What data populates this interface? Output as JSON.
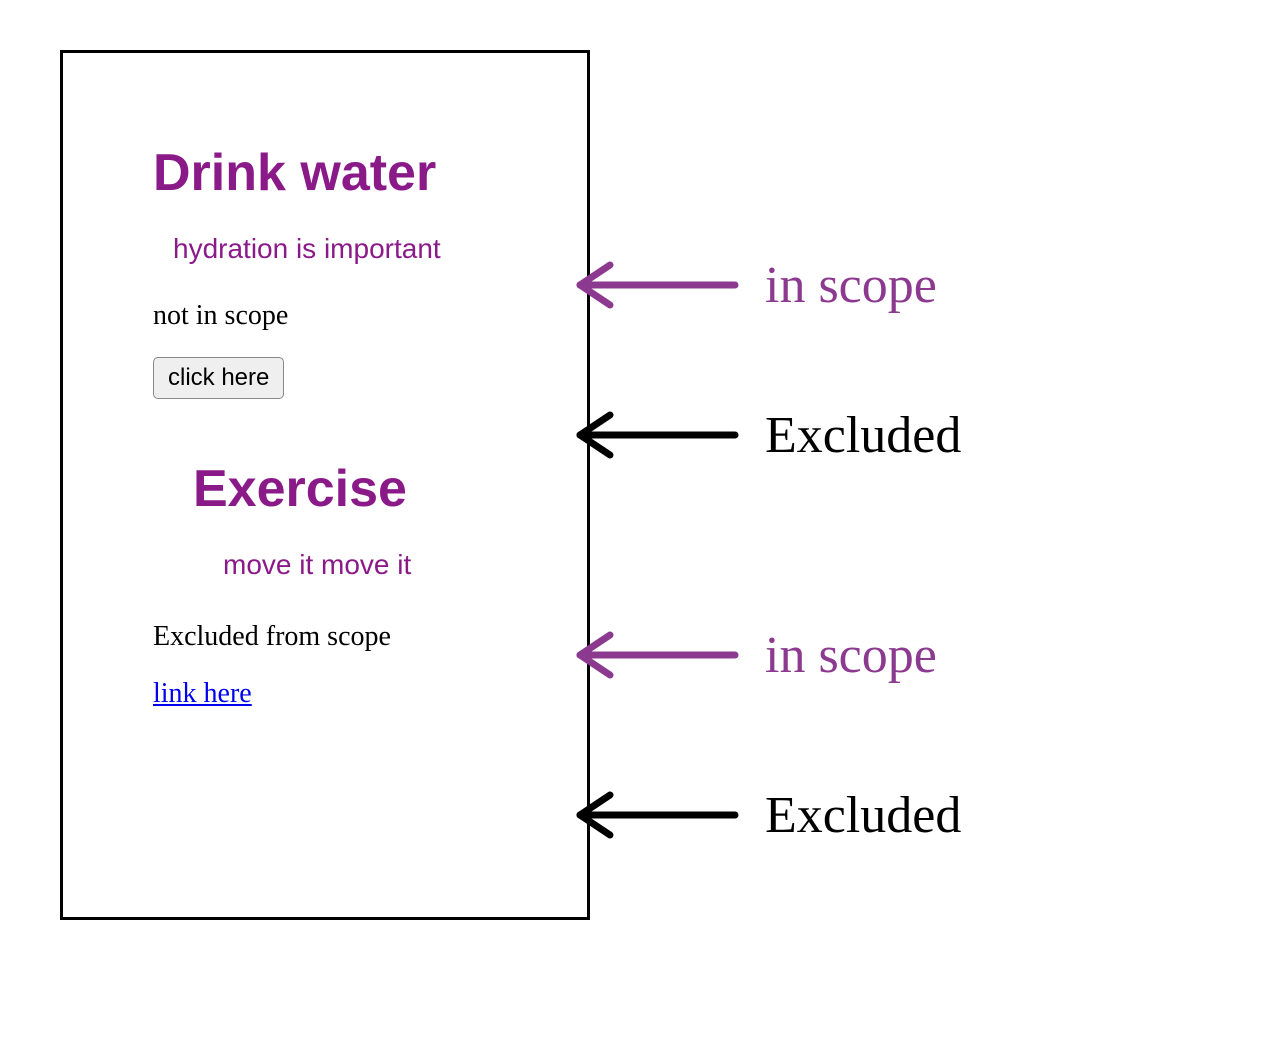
{
  "panel": {
    "section1": {
      "heading": "Drink water",
      "subtext": "hydration is important",
      "plain": "not in scope",
      "button": "click here"
    },
    "section2": {
      "heading": "Exercise",
      "subtext": "move it move it",
      "plain": "Excluded from scope",
      "link": "link here"
    }
  },
  "annotations": {
    "in_scope_1": "in scope",
    "excluded_1": "Excluded",
    "in_scope_2": "in scope",
    "excluded_2": "Excluded"
  },
  "colors": {
    "purple": "#8b3a8f",
    "heading_purple": "#8b1a89",
    "black": "#000000",
    "link_blue": "#0000ee"
  }
}
